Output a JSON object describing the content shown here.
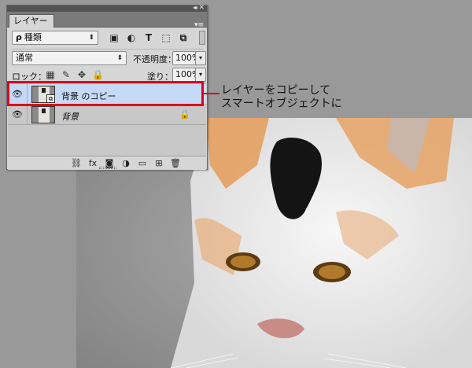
{
  "panel": {
    "tab_label": "レイヤー",
    "collapse_glyph": "◂◂",
    "close_glyph": "✕",
    "menu_glyph": "▾≡"
  },
  "filter": {
    "search_glyph": "ρ",
    "kind_value": "種類",
    "updown_glyph": "⬍",
    "icons": [
      {
        "name": "pixel-layer-filter-icon",
        "glyph": "▣"
      },
      {
        "name": "adjustment-layer-filter-icon",
        "glyph": "◐"
      },
      {
        "name": "type-layer-filter-icon",
        "glyph": "T"
      },
      {
        "name": "shape-layer-filter-icon",
        "glyph": "⬚"
      },
      {
        "name": "smart-object-filter-icon",
        "glyph": "⧉"
      }
    ]
  },
  "blend": {
    "mode_value": "通常",
    "opacity_label": "不透明度：",
    "opacity_value": "100%",
    "dropdown_glyph": "▾"
  },
  "lock": {
    "label": "ロック：",
    "icons": [
      {
        "name": "lock-transparent-pixels-icon",
        "glyph": "▦"
      },
      {
        "name": "lock-image-pixels-icon",
        "glyph": "✎"
      },
      {
        "name": "lock-position-icon",
        "glyph": "✥"
      },
      {
        "name": "lock-all-icon",
        "glyph": "🔒"
      }
    ],
    "fill_label": "塗り：",
    "fill_value": "100%"
  },
  "layers": [
    {
      "name": "背景 のコピー",
      "selected": true,
      "visible_glyph": "👁",
      "smart_badge": "⧉"
    },
    {
      "name": "背景",
      "selected": false,
      "visible_glyph": "👁",
      "lock_glyph": "🔒"
    }
  ],
  "footer_icons": [
    {
      "name": "link-layers-icon",
      "glyph": "⛓"
    },
    {
      "name": "layer-style-fx-icon",
      "glyph": "fx"
    },
    {
      "name": "add-mask-icon",
      "glyph": "◙"
    },
    {
      "name": "adjustment-layer-icon",
      "glyph": "◑"
    },
    {
      "name": "new-group-folder-icon",
      "glyph": "▭"
    },
    {
      "name": "new-layer-icon",
      "glyph": "⊞"
    },
    {
      "name": "trash-icon",
      "glyph": "🗑"
    }
  ],
  "callout": {
    "line1": "レイヤーをコピーして",
    "line2": "スマートオブジェクトに"
  },
  "colors": {
    "highlight": "#e0001b",
    "selected_row": "#c5daf6"
  }
}
